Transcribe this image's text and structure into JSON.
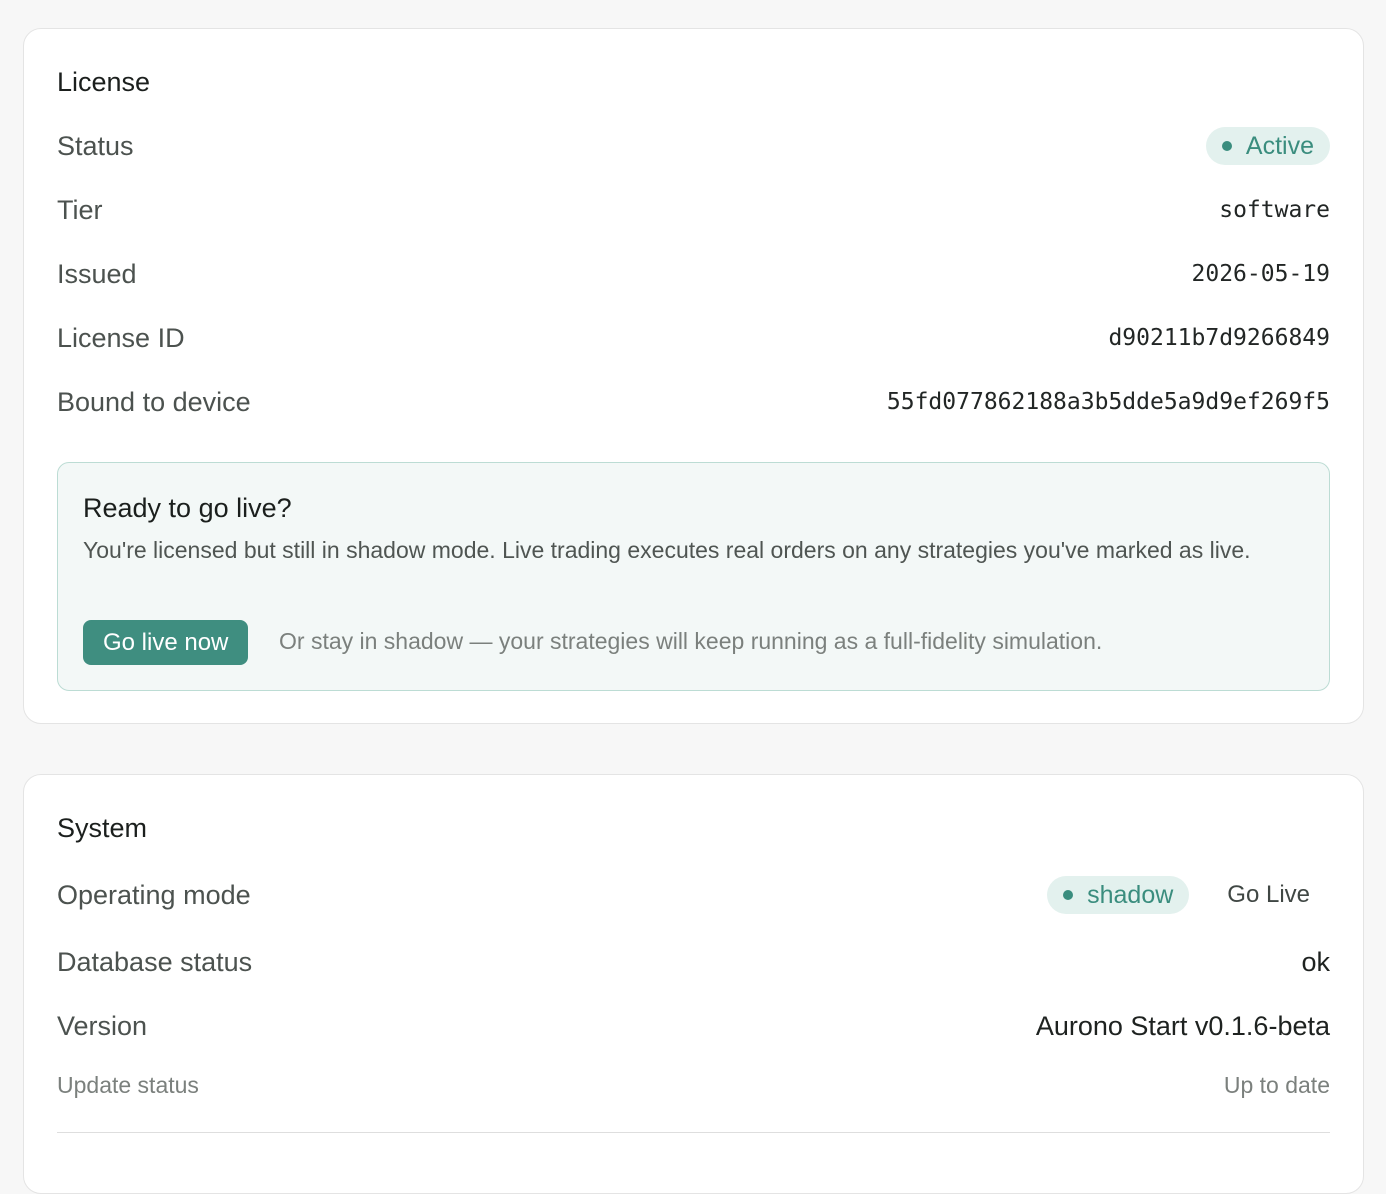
{
  "license": {
    "title": "License",
    "rows": [
      {
        "label": "Status",
        "value": "Active"
      },
      {
        "label": "Tier",
        "value": "software"
      },
      {
        "label": "Issued",
        "value": "2026-05-19"
      },
      {
        "label": "License ID",
        "value": "d90211b7d9266849"
      },
      {
        "label": "Bound to device",
        "value": "55fd077862188a3b5dde5a9d9ef269f5"
      }
    ],
    "golive": {
      "title": "Ready to go live?",
      "description": "You're licensed but still in shadow mode. Live trading executes real orders on any strategies you've marked as live.",
      "button_label": "Go live now",
      "note": "Or stay in shadow — your strategies will keep running as a full-fidelity simulation."
    }
  },
  "system": {
    "title": "System",
    "operating_mode": {
      "label": "Operating mode",
      "value": "shadow",
      "action_label": "Go Live"
    },
    "database_status": {
      "label": "Database status",
      "value": "ok"
    },
    "version": {
      "label": "Version",
      "value": "Aurono Start v0.1.6-beta"
    },
    "update_status": {
      "label": "Update status",
      "value": "Up to date"
    }
  },
  "colors": {
    "accent": "#3f8e80",
    "pill_bg": "#e3f1ee",
    "panel_bg": "#f3f8f7"
  }
}
